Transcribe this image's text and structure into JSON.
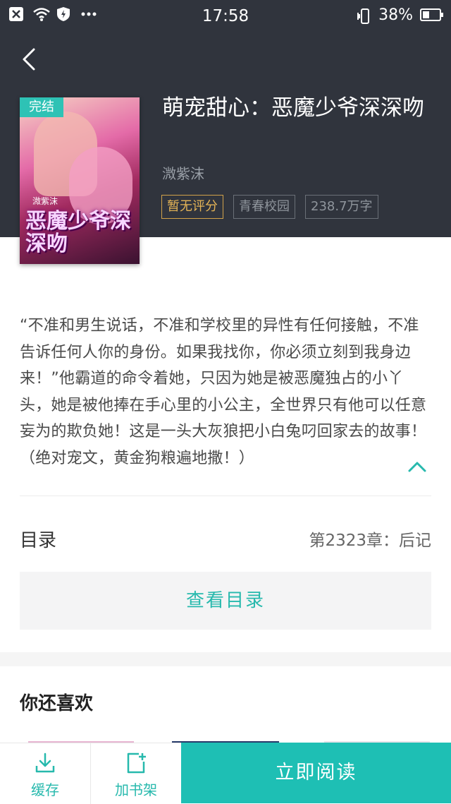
{
  "status_bar": {
    "time": "17:58",
    "battery": "38%",
    "icons": [
      "close-box-icon",
      "wifi-icon",
      "shield-icon",
      "more-dots-icon",
      "vibrate-phone-icon",
      "battery-icon"
    ]
  },
  "colors": {
    "header_bg": "#30343d",
    "accent": "#1ebfb4",
    "rating_tag": "#e3b356"
  },
  "book": {
    "status_badge": "完结",
    "title": "萌宠甜心：恶魔少爷深深吻",
    "author": "溦紫沫",
    "cover_title": "恶魔少爷深深吻",
    "tags": {
      "rating": "暂无评分",
      "category": "青春校园",
      "word_count": "238.7万字"
    },
    "description": "“不准和男生说话，不准和学校里的异性有任何接触，不准告诉任何人你的身份。如果我找你，你必须立刻到我身边来！”他霸道的命令着她，只因为她是被恶魔独占的小丫头，她是被他捧在手心里的小公主，全世界只有他可以任意妄为的欺负她！这是一头大灰狼把小白兔叼回家去的故事！（绝对宠文，黄金狗粮遍地撒！）"
  },
  "toc": {
    "label": "目录",
    "latest_chapter": "第2323章：后记",
    "view_button": "查看目录"
  },
  "recommend": {
    "title": "你还喜欢"
  },
  "bottom_bar": {
    "cache_label": "缓存",
    "add_shelf_label": "加书架",
    "read_now_label": "立即阅读"
  }
}
